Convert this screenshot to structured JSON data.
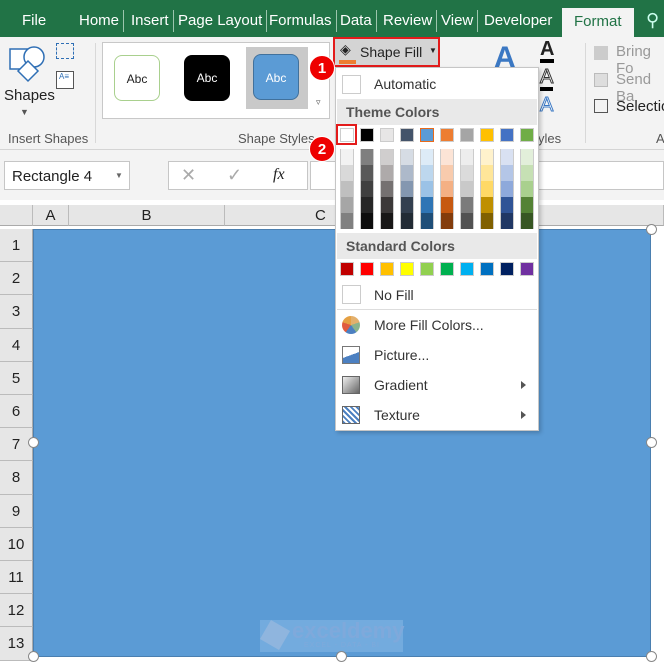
{
  "tabs": [
    "File",
    "Home",
    "Insert",
    "Page Layout",
    "Formulas",
    "Data",
    "Review",
    "View",
    "Developer",
    "Format"
  ],
  "active_tab": "Format",
  "ribbon": {
    "shapes_label": "Shapes",
    "insert_shapes_label": "Insert Shapes",
    "style_samples": [
      "Abc",
      "Abc",
      "Abc"
    ],
    "shape_styles_label": "Shape Styles",
    "shape_fill_label": "Shape Fill",
    "wordart_styles_label": "yles",
    "bring_forward": "Bring Fo",
    "send_backward": "Send Ba",
    "selection_pane": "Selectio",
    "arrange_label": "A"
  },
  "steps": [
    "1",
    "2"
  ],
  "formula_bar": {
    "name_box": "Rectangle 4",
    "fx": "fx",
    "value": ""
  },
  "grid": {
    "columns": [
      "A",
      "B",
      "C"
    ],
    "rows": [
      "1",
      "2",
      "3",
      "4",
      "5",
      "6",
      "7",
      "8",
      "9",
      "10",
      "11",
      "12",
      "13"
    ]
  },
  "shape": {
    "fill": "#5B9BD5"
  },
  "watermark": {
    "name": "exceldemy",
    "tagline": "EXCEL - DATA - BI"
  },
  "menu": {
    "automatic": "Automatic",
    "theme_header": "Theme Colors",
    "theme_colors": [
      "#FFFFFF",
      "#000000",
      "#E7E6E6",
      "#44546A",
      "#5B9BD5",
      "#ED7D31",
      "#A5A5A5",
      "#FFC000",
      "#4472C4",
      "#70AD47"
    ],
    "theme_shades": [
      [
        "#F2F2F2",
        "#D9D9D9",
        "#BFBFBF",
        "#A6A6A6",
        "#808080"
      ],
      [
        "#7F7F7F",
        "#595959",
        "#404040",
        "#262626",
        "#0D0D0D"
      ],
      [
        "#D0CECE",
        "#AEAAAA",
        "#757171",
        "#3B3838",
        "#181717"
      ],
      [
        "#D6DCE4",
        "#ADB9CA",
        "#8497B0",
        "#333F4F",
        "#222B35"
      ],
      [
        "#DDEBF7",
        "#BDD7EE",
        "#9BC2E6",
        "#2F75B5",
        "#1F4E78"
      ],
      [
        "#FCE4D6",
        "#F8CBAD",
        "#F4B084",
        "#C65911",
        "#833C0C"
      ],
      [
        "#EDEDED",
        "#DBDBDB",
        "#C9C9C9",
        "#7B7B7B",
        "#525252"
      ],
      [
        "#FFF2CC",
        "#FFE699",
        "#FFD966",
        "#BF8F00",
        "#806000"
      ],
      [
        "#D9E1F2",
        "#B4C6E7",
        "#8EA9DB",
        "#305496",
        "#203764"
      ],
      [
        "#E2EFDA",
        "#C6E0B4",
        "#A9D08E",
        "#548235",
        "#375623"
      ]
    ],
    "standard_header": "Standard Colors",
    "standard_colors": [
      "#C00000",
      "#FF0000",
      "#FFC000",
      "#FFFF00",
      "#92D050",
      "#00B050",
      "#00B0F0",
      "#0070C0",
      "#002060",
      "#7030A0"
    ],
    "no_fill": "No Fill",
    "more_colors": "More Fill Colors...",
    "picture": "Picture...",
    "gradient": "Gradient",
    "texture": "Texture"
  }
}
